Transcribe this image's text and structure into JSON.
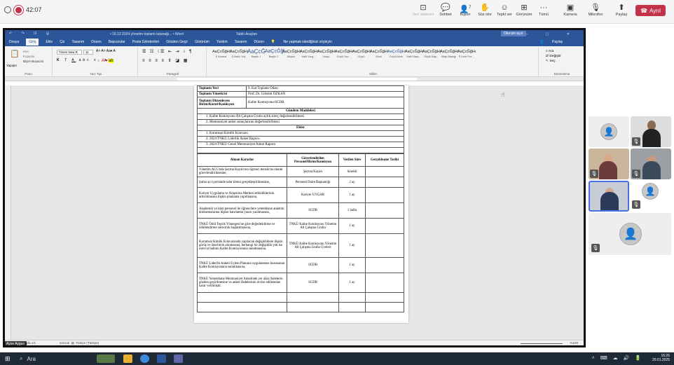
{
  "teams": {
    "timer": "42:07",
    "buttons": [
      {
        "label": "Veri aktarımı",
        "icon": "data-icon"
      },
      {
        "label": "Sohbet",
        "icon": "chat-icon"
      },
      {
        "label": "Kişiler",
        "icon": "people-icon",
        "count": "7"
      },
      {
        "label": "Söz iste",
        "icon": "raise-hand-icon"
      },
      {
        "label": "Tepki ver",
        "icon": "emoji-icon"
      },
      {
        "label": "Görünüm",
        "icon": "grid-icon"
      },
      {
        "label": "Tümü",
        "icon": "more-icon"
      },
      {
        "label": "Kamera",
        "icon": "camera-icon"
      },
      {
        "label": "Mikrofon",
        "icon": "mic-icon"
      },
      {
        "label": "Paylaş",
        "icon": "share-icon"
      }
    ],
    "leave_label": "Ayrıl",
    "colors": {
      "leave": "#c4314b",
      "active_tile": "#4a6fe0"
    }
  },
  "word": {
    "title": "• 16.12.2024 yönetim toplantı tutanağı... • Word",
    "search": "Tablo Araçları",
    "sign_in": "Oturum açın",
    "menu": [
      "Dosya",
      "Giriş",
      "Ekle",
      "Çiz",
      "Tasarım",
      "Düzen",
      "Başvurular",
      "Posta Gönderileri",
      "Gözden Geçir",
      "Görünüm",
      "Yardım",
      "Tasarım",
      "Düzen"
    ],
    "tell_me": "Ne yapmak istediğinizi söyleyin",
    "share": "Paylaş",
    "paste_label": "Yapıştır",
    "clipboard_items": [
      "Kes",
      "Kopyala",
      "Biçim Boyacısı"
    ],
    "font_name": "Times New R",
    "font_size": "11",
    "groups": [
      "Pano",
      "Yazı Tipi",
      "Paragraf",
      "Stiller",
      "Düzenleme"
    ],
    "styles": [
      {
        "sample": "AaÇcĞğHı",
        "name": "¶ Normal"
      },
      {
        "sample": "AaÇcĞğHı",
        "name": "¶ Aralık Yok"
      },
      {
        "sample": "AaÇcĞ",
        "name": "Başlık 1"
      },
      {
        "sample": "AaÇcĞğl",
        "name": "Başlık 2"
      },
      {
        "sample": "AaÇcĞğHı",
        "name": "Altyazı"
      },
      {
        "sample": "AaÇcĞğHı",
        "name": "Hafif Vurg..."
      },
      {
        "sample": "AaÇcĞğHı",
        "name": "Vurgu"
      },
      {
        "sample": "AaÇcĞğHı",
        "name": "Güçlü Vur..."
      },
      {
        "sample": "AaÇcĞğHı",
        "name": "Güçlü"
      },
      {
        "sample": "AaÇcĞğHı",
        "name": "Alıntı"
      },
      {
        "sample": "AaÇcĞğHı",
        "name": "Güçlü Alıntı"
      },
      {
        "sample": "AaÇcĞğHı",
        "name": "Hafif Başv..."
      },
      {
        "sample": "AaÇcĞğHı",
        "name": "Güçlü Baş..."
      },
      {
        "sample": "AaÇcĞğHı",
        "name": "Kitap Başlığı"
      },
      {
        "sample": "AaÇcĞğHı",
        "name": "¶ Liste Par..."
      }
    ],
    "editing": [
      "Ara",
      "Değiştir",
      "Seç"
    ],
    "status": {
      "page": "Sayfa 1/1",
      "words": "sözcük",
      "lang": "Türkçe (Türkiye)",
      "zoom": "%100"
    }
  },
  "doc": {
    "info_rows": [
      {
        "k": "Toplantı Yeri",
        "v": "9. Kat Toplantı Odası"
      },
      {
        "k": "Toplantı Yöneticisi",
        "v": "Prof. Dr. Gülsüm ÖZKAN"
      },
      {
        "k": "Toplantı Düzenleyen Birim/Kurul/Komisyon",
        "v": "Kalite Komisyonu/SGDB"
      }
    ],
    "agenda_title": "Gündem Maddeleri",
    "agenda": [
      "1.   Kalite Komisyonu Alt Çalışma Grubu aylık süreç değerlendirilmesi",
      "2.   Memnuniyet anket sonuçlarının değerlendirilmesi"
    ],
    "attach_title": "Ekler",
    "attachments": [
      "1.   Kurumsal Kimlik Kılavuzu",
      "2.   2024 TNKÜ Liderlik Anket Raporu",
      "3.   2024 TNKÜ Genel Memnuniyet Anket Raporu"
    ],
    "headers": [
      "Alınan Kararlar",
      "Görevlendirilen Personel/Birim/Komisyon",
      "Verilen Süre",
      "Gerçekleşme Tarihi"
    ],
    "rows": [
      {
        "d": "Yönetim ACG'nda Şeyma Kayalı'nın öğrenci temsilcisi olarak görevlendirilmesine,",
        "p": "Şeyma Kayalı",
        "s": "Sürekli"
      },
      {
        "d": "Şubat ayı içerisinde talut töreni gerçekleştirilmesine,",
        "p": "Personel Daire Başkanlığı",
        "s": "2 ay"
      },
      {
        "d": "Kariyer Uygulama ve Araştırma Merkezi etkinliklerinin arttırılmasına ilişkin planlama yapılmasına,",
        "p": "Kariyer UYGAR",
        "s": "1 ay"
      },
      {
        "d": "Akademik ve idari personel ile öğrencilere yemekhane anketini doldurmalarına ilişkin hatırlatma yazısı yazılmasına,",
        "p": "SGDB",
        "s": "1 hafta"
      },
      {
        "d": "TNKÜ Ödül Teşvik Yönergesi'ne göre değerlendirme ve ödüllendirme sürecinin başlatılmasına,",
        "p": "TNKÜ Kalite Komisyonu Yönetim Alt Çalışma Grubu",
        "s": "1 ay"
      },
      {
        "d": "Kurumsal Kimlik Kılavuzunda yapılacak değişikliklere ilişkin görüş ve önerilerin alınmasına, herhangi bir değişiklik yok ise mevcut halinin Kalite Komisyonuna sunulmasına,",
        "p": "TNKÜ Kalite Komisyonu Yönetim Alt Çalışma Grubu Üyeleri",
        "s": "1 ay"
      },
      {
        "d": "TNKÜ Liderlik Anketi Eylem Planının uygulanması hususunun Kalite Komisyonuna sunulmasına,",
        "p": "SGDB",
        "s": "1 ay"
      },
      {
        "d": "TNKÜ Yemekhane Memnuniyet Anketinde yer alan ifadelerin gözden geçirilmesine ve anket ifadelerinin revize edilmesine karar verilmiştir.",
        "p": "SGDB",
        "s": "1 ay"
      }
    ]
  },
  "presenter": "Ayse Aygun",
  "taskbar": {
    "search": "Ara",
    "time": "16:26",
    "date": "20.01.2025"
  }
}
